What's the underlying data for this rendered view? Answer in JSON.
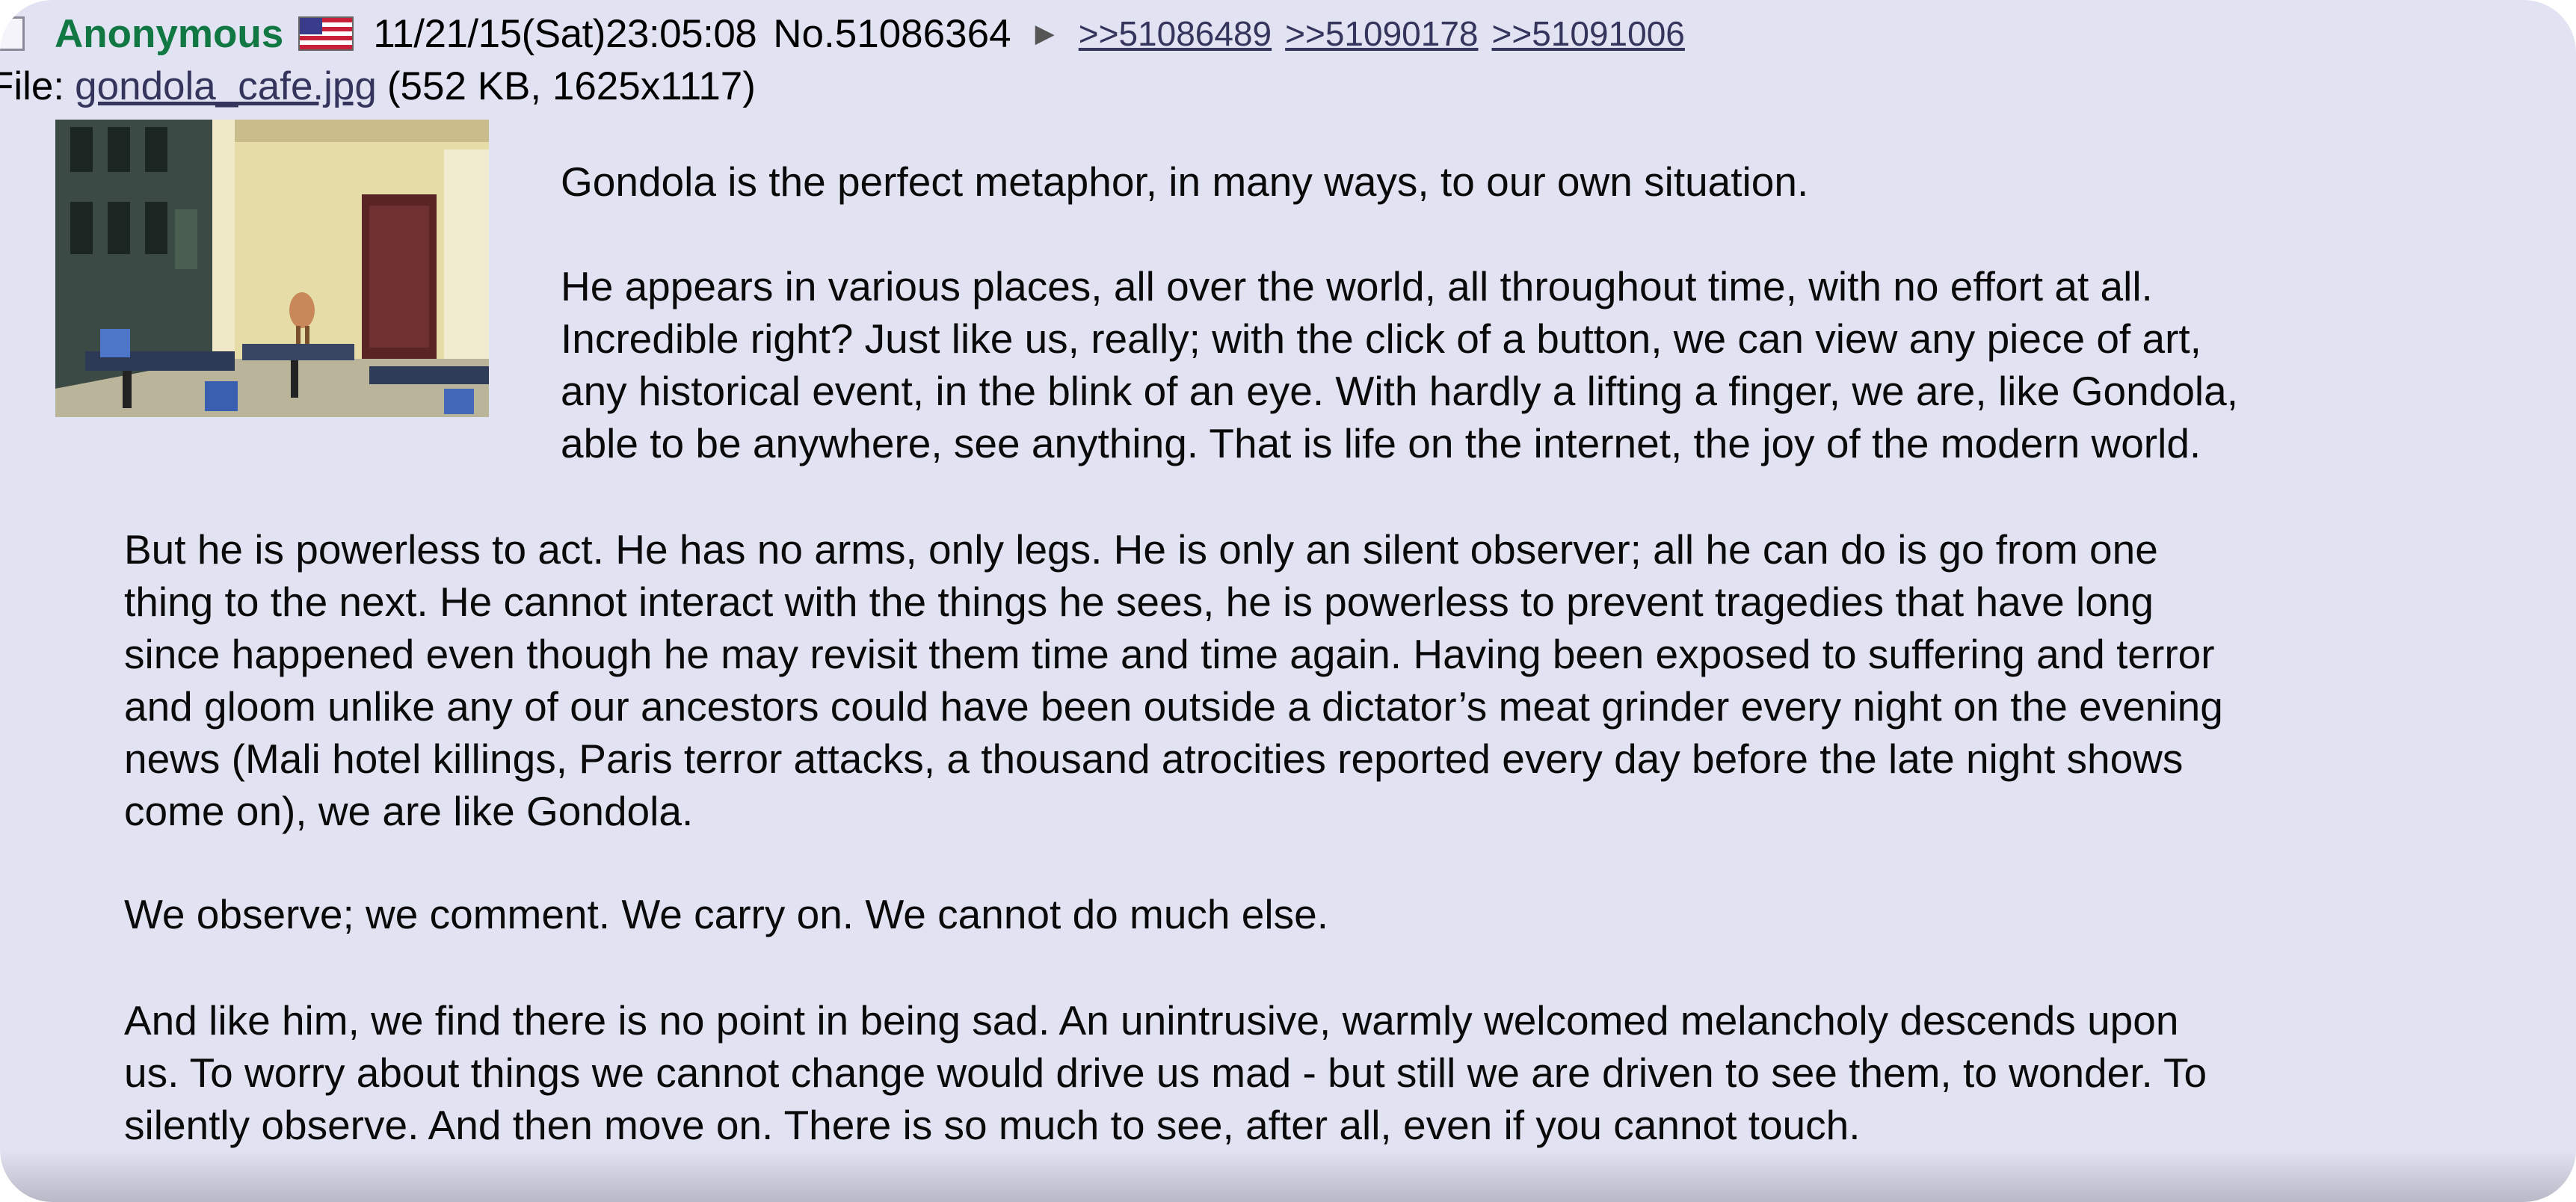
{
  "post": {
    "name": "Anonymous",
    "flag_icon": "us-flag-icon",
    "datetime": "11/21/15(Sat)23:05:08",
    "post_number": "No.51086364",
    "menu_arrow": "▶",
    "backlinks": [
      ">>51086489",
      ">>51090178",
      ">>51091006"
    ],
    "file_label": "File:",
    "file_name": "gondola_cafe.jpg",
    "file_meta": "(552 KB, 1625x1117)",
    "thumbnail_icon": "cafe-scene-thumbnail",
    "message": {
      "para1": [
        "Gondola is the perfect metaphor, in many ways, to our own situation."
      ],
      "para2": [
        "He appears in various places, all over the world, all throughout time, with no effort at all.",
        "Incredible right? Just like us, really; with the click of a button, we can view any piece of art,",
        "any historical event, in the blink of an eye. With hardly a lifting a finger, we are, like Gondola,",
        "able to be anywhere, see anything. That is life on the internet, the joy of the modern world."
      ],
      "para3": [
        "But he is powerless to act. He has no arms, only legs. He is only an silent observer; all he can do is go from one",
        "thing to the next. He cannot interact with the things he sees, he is powerless to prevent tragedies that have long",
        "since happened even though he may revisit them time and time again. Having been exposed to suffering and terror",
        "and gloom unlike any of our ancestors could have been outside a dictator’s meat grinder every night on the evening",
        "news (Mali hotel killings, Paris terror attacks, a thousand atrocities reported every day before the late night shows",
        "come on), we are like Gondola."
      ],
      "para4": [
        "We observe; we comment. We carry on. We cannot do much else."
      ],
      "para5": [
        "And like him, we find there is no point in being sad. An unintrusive, warmly welcomed melancholy descends upon",
        "us. To worry about things we cannot change would drive us mad - but still we are driven to see them, to wonder. To",
        "silently observe. And then move on. There is so much to see, after all, even if you cannot touch."
      ]
    }
  },
  "colors": {
    "background": "#e2e3f2",
    "name": "#117743",
    "link": "#34345c",
    "text": "#0a0a0a"
  }
}
